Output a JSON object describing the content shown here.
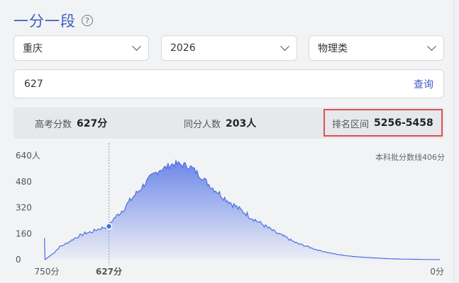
{
  "header": {
    "title": "一分一段",
    "help_icon": "question-circle-icon"
  },
  "filters": {
    "region": "重庆",
    "year": "2026",
    "subject": "物理类"
  },
  "query": {
    "value": "627",
    "button": "查询"
  },
  "stats": [
    {
      "label": "高考分数",
      "value": "627分"
    },
    {
      "label": "同分人数",
      "value": "203人"
    },
    {
      "label": "排名区间",
      "value": "5256-5458"
    }
  ],
  "chart_data": {
    "type": "area",
    "y_ticks": [
      "640人",
      "480",
      "320",
      "160",
      "0"
    ],
    "x_labels": [
      "750分",
      "627分",
      "0分"
    ],
    "x_range": [
      750,
      0
    ],
    "ylim": [
      0,
      640
    ],
    "annotation": "本科批分数线406分",
    "marker": {
      "x": 627,
      "y": 205
    },
    "points": [
      {
        "x": 750,
        "y": 130
      },
      {
        "x": 749,
        "y": 130
      },
      {
        "x": 748,
        "y": 0
      },
      {
        "x": 740,
        "y": 20
      },
      {
        "x": 730,
        "y": 45
      },
      {
        "x": 720,
        "y": 80
      },
      {
        "x": 710,
        "y": 95
      },
      {
        "x": 700,
        "y": 115
      },
      {
        "x": 690,
        "y": 135
      },
      {
        "x": 680,
        "y": 150
      },
      {
        "x": 670,
        "y": 165
      },
      {
        "x": 660,
        "y": 170
      },
      {
        "x": 650,
        "y": 185
      },
      {
        "x": 640,
        "y": 195
      },
      {
        "x": 627,
        "y": 205
      },
      {
        "x": 620,
        "y": 245
      },
      {
        "x": 610,
        "y": 275
      },
      {
        "x": 600,
        "y": 310
      },
      {
        "x": 590,
        "y": 350
      },
      {
        "x": 580,
        "y": 390
      },
      {
        "x": 570,
        "y": 425
      },
      {
        "x": 560,
        "y": 465
      },
      {
        "x": 550,
        "y": 500
      },
      {
        "x": 540,
        "y": 530
      },
      {
        "x": 530,
        "y": 555
      },
      {
        "x": 520,
        "y": 565
      },
      {
        "x": 510,
        "y": 585
      },
      {
        "x": 500,
        "y": 590
      },
      {
        "x": 490,
        "y": 585
      },
      {
        "x": 480,
        "y": 580
      },
      {
        "x": 470,
        "y": 565
      },
      {
        "x": 460,
        "y": 535
      },
      {
        "x": 450,
        "y": 505
      },
      {
        "x": 440,
        "y": 470
      },
      {
        "x": 430,
        "y": 440
      },
      {
        "x": 420,
        "y": 415
      },
      {
        "x": 410,
        "y": 385
      },
      {
        "x": 400,
        "y": 360
      },
      {
        "x": 390,
        "y": 335
      },
      {
        "x": 380,
        "y": 310
      },
      {
        "x": 370,
        "y": 290
      },
      {
        "x": 360,
        "y": 265
      },
      {
        "x": 350,
        "y": 245
      },
      {
        "x": 340,
        "y": 225
      },
      {
        "x": 330,
        "y": 205
      },
      {
        "x": 320,
        "y": 185
      },
      {
        "x": 310,
        "y": 165
      },
      {
        "x": 300,
        "y": 150
      },
      {
        "x": 290,
        "y": 135
      },
      {
        "x": 280,
        "y": 115
      },
      {
        "x": 270,
        "y": 100
      },
      {
        "x": 260,
        "y": 90
      },
      {
        "x": 250,
        "y": 80
      },
      {
        "x": 240,
        "y": 68
      },
      {
        "x": 230,
        "y": 58
      },
      {
        "x": 220,
        "y": 50
      },
      {
        "x": 210,
        "y": 42
      },
      {
        "x": 200,
        "y": 36
      },
      {
        "x": 190,
        "y": 30
      },
      {
        "x": 180,
        "y": 26
      },
      {
        "x": 170,
        "y": 22
      },
      {
        "x": 160,
        "y": 19
      },
      {
        "x": 150,
        "y": 16
      },
      {
        "x": 140,
        "y": 14
      },
      {
        "x": 130,
        "y": 12
      },
      {
        "x": 120,
        "y": 10
      },
      {
        "x": 110,
        "y": 8
      },
      {
        "x": 100,
        "y": 6
      },
      {
        "x": 90,
        "y": 5
      },
      {
        "x": 80,
        "y": 4
      },
      {
        "x": 70,
        "y": 3
      },
      {
        "x": 60,
        "y": 3
      },
      {
        "x": 50,
        "y": 2
      },
      {
        "x": 40,
        "y": 2
      },
      {
        "x": 30,
        "y": 1
      },
      {
        "x": 20,
        "y": 1
      },
      {
        "x": 10,
        "y": 1
      },
      {
        "x": 0,
        "y": 0
      }
    ]
  },
  "colors": {
    "accent": "#3b5bc4",
    "series": "#4d6fe0",
    "highlight": "#e05050"
  }
}
